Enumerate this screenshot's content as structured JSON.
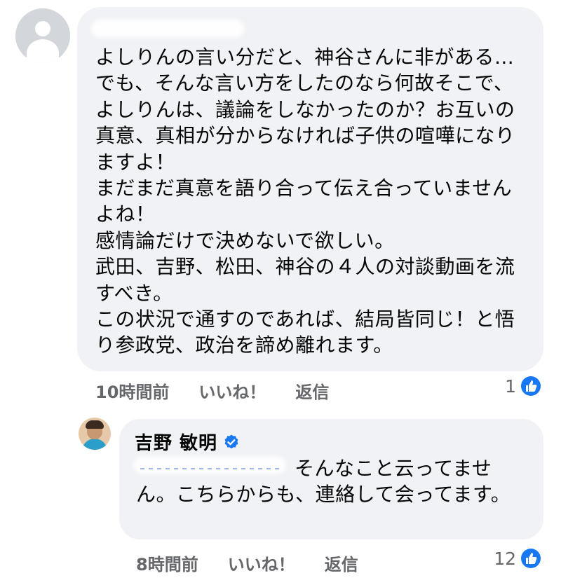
{
  "comments": [
    {
      "author_redacted": true,
      "text": "よしりんの言い分だと、神谷さんに非がある…でも、そんな言い方をしたのなら何故そこで、よしりんは、議論をしなかったのか？お互いの真意、真相が分からなければ子供の喧嘩になりますよ！\nまだまだ真意を語り合って伝え合っていませんよね！\n感情論だけで決めないで欲しい。\n武田、吉野、松田、神谷の４人の対談動画を流すべき。\nこの状況で通すのであれば、結局皆同じ！と悟り参政党、政治を諦め離れます。",
      "timestamp": "10時間前",
      "like_label": "いいね！",
      "reply_label": "返信",
      "reaction_count": "1"
    },
    {
      "author": "吉野 敏明",
      "verified": true,
      "mention_redacted": true,
      "text": "そんなこと云ってません。こちらからも、連絡して会ってます。",
      "timestamp": "8時間前",
      "like_label": "いいね！",
      "reply_label": "返信",
      "reaction_count": "12"
    }
  ],
  "colors": {
    "bubble": "#f0f2f5",
    "meta_text": "#65676b",
    "accent": "#1877f2"
  },
  "icons": {
    "verified": "verified-badge-icon",
    "like": "thumbs-up-icon"
  }
}
